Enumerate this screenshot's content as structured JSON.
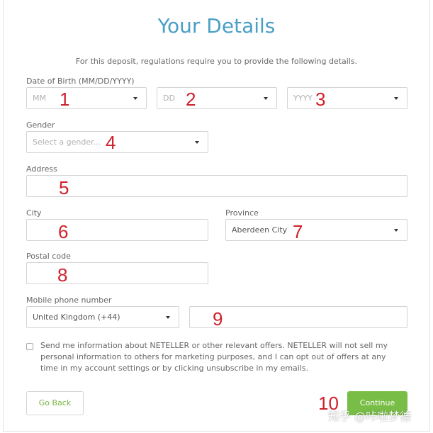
{
  "header": {
    "title": "Your Details",
    "intro": "For this deposit, regulations require you to provide the following details."
  },
  "dob": {
    "label": "Date of Birth (MM/DD/YYYY)",
    "month_placeholder": "MM",
    "day_placeholder": "DD",
    "year_placeholder": "YYYY"
  },
  "gender": {
    "label": "Gender",
    "placeholder": "Select a gender..."
  },
  "address": {
    "label": "Address",
    "value": ""
  },
  "city": {
    "label": "City",
    "value": ""
  },
  "province": {
    "label": "Province",
    "value": "Aberdeen City"
  },
  "postal_code": {
    "label": "Postal code",
    "value": ""
  },
  "phone": {
    "label": "Mobile phone number",
    "country": "United Kingdom (+44)",
    "number": ""
  },
  "consent": {
    "text": "Send me information about NETELLER or other relevant offers. NETELLER will not sell my personal information to others for marketing purposes, and I can opt out of offers at any time in my account settings or by clicking unsubscribe in my emails.",
    "checked": false
  },
  "buttons": {
    "back": "Go Back",
    "continue": "Continue"
  },
  "annotations": [
    "1",
    "2",
    "3",
    "4",
    "5",
    "6",
    "7",
    "8",
    "9",
    "10"
  ],
  "watermark": "知乎 @咔啦梦德"
}
